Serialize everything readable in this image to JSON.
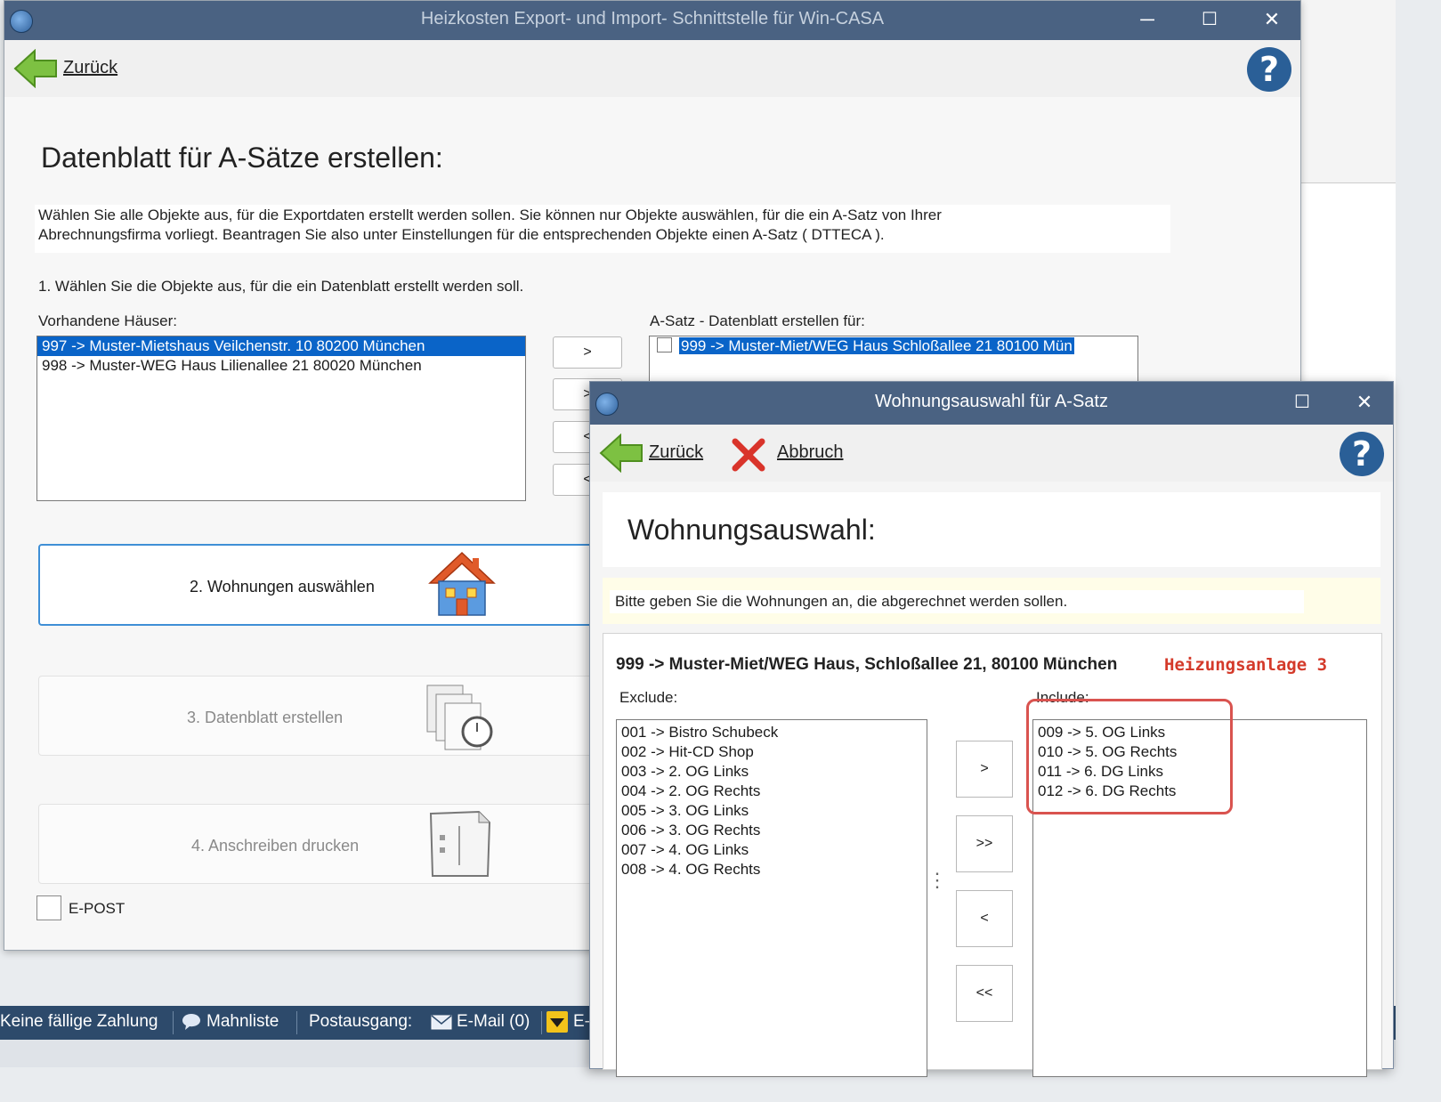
{
  "main_window": {
    "title": "Heizkosten Export- und Import- Schnittstelle für Win-CASA",
    "controls": {
      "minimize": "─",
      "maximize": "☐",
      "close": "✕"
    },
    "toolbar": {
      "back_label": "Zurück",
      "help_label": "?"
    },
    "heading": "Datenblatt für A-Sätze erstellen:",
    "intro_line1": "Wählen Sie alle Objekte aus, für die Exportdaten erstellt werden sollen. Sie können nur Objekte auswählen, für die ein A-Satz von Ihrer",
    "intro_line2": "Abrechnungsfirma vorliegt. Beantragen Sie also unter Einstellungen für die entsprechenden Objekte einen A-Satz ( DTTECA ).",
    "step1_label": "1. Wählen Sie die Objekte aus, für die ein Datenblatt erstellt werden soll.",
    "available_label": "Vorhandene Häuser:",
    "available_houses": [
      "997 -> Muster-Mietshaus  Veilchenstr. 10   80200 München",
      "998 -> Muster-WEG Haus  Lilienallee 21   80020 München"
    ],
    "target_label": "A-Satz - Datenblatt erstellen für:",
    "target_houses": [
      "999 -> Muster-Miet/WEG Haus  Schloßallee 21   80100 Mün"
    ],
    "move_buttons": [
      ">",
      ">",
      "<",
      "<"
    ],
    "step2_label": "2. Wohnungen auswählen",
    "step3_label": "3. Datenblatt erstellen",
    "step4_label": "4. Anschreiben drucken",
    "epost_label": "E-POST"
  },
  "statusbar": {
    "payment": "Keine fällige Zahlung",
    "reminder": "Mahnliste",
    "outbox_label": "Postausgang:",
    "email": "E-Mail (0)",
    "epost_cut": "E-"
  },
  "dialog": {
    "title": "Wohnungsauswahl für A-Satz",
    "controls": {
      "maximize": "☐",
      "close": "✕"
    },
    "toolbar": {
      "back_label": "Zurück",
      "cancel_label": "Abbruch",
      "help_label": "?"
    },
    "heading": "Wohnungsauswahl:",
    "note": "Bitte geben Sie die Wohnungen an, die abgerechnet werden sollen.",
    "property": "999 -> Muster-Miet/WEG Haus, Schloßallee 21, 80100 München",
    "heating": "Heizungsanlage 3",
    "exclude_label": "Exclude:",
    "include_label": "Include:",
    "exclude_items": [
      "001 -> Bistro Schubeck",
      "002 -> Hit-CD Shop",
      "003 -> 2. OG Links",
      "004 -> 2. OG Rechts",
      "005 -> 3. OG Links",
      "006 -> 3. OG Rechts",
      "007 -> 4. OG Links",
      "008 -> 4. OG Rechts"
    ],
    "include_items": [
      "009 -> 5. OG Links",
      "010 -> 5. OG Rechts",
      "011 -> 6. DG Links",
      "012 -> 6. DG Rechts"
    ],
    "move_buttons": [
      ">",
      ">>",
      "<",
      "<<"
    ],
    "splitter": "⋮"
  },
  "colors": {
    "accent": "#0a64c8",
    "titlebar": "#4a6282",
    "highlight": "#d9534f",
    "heating_text": "#d43a2a"
  }
}
